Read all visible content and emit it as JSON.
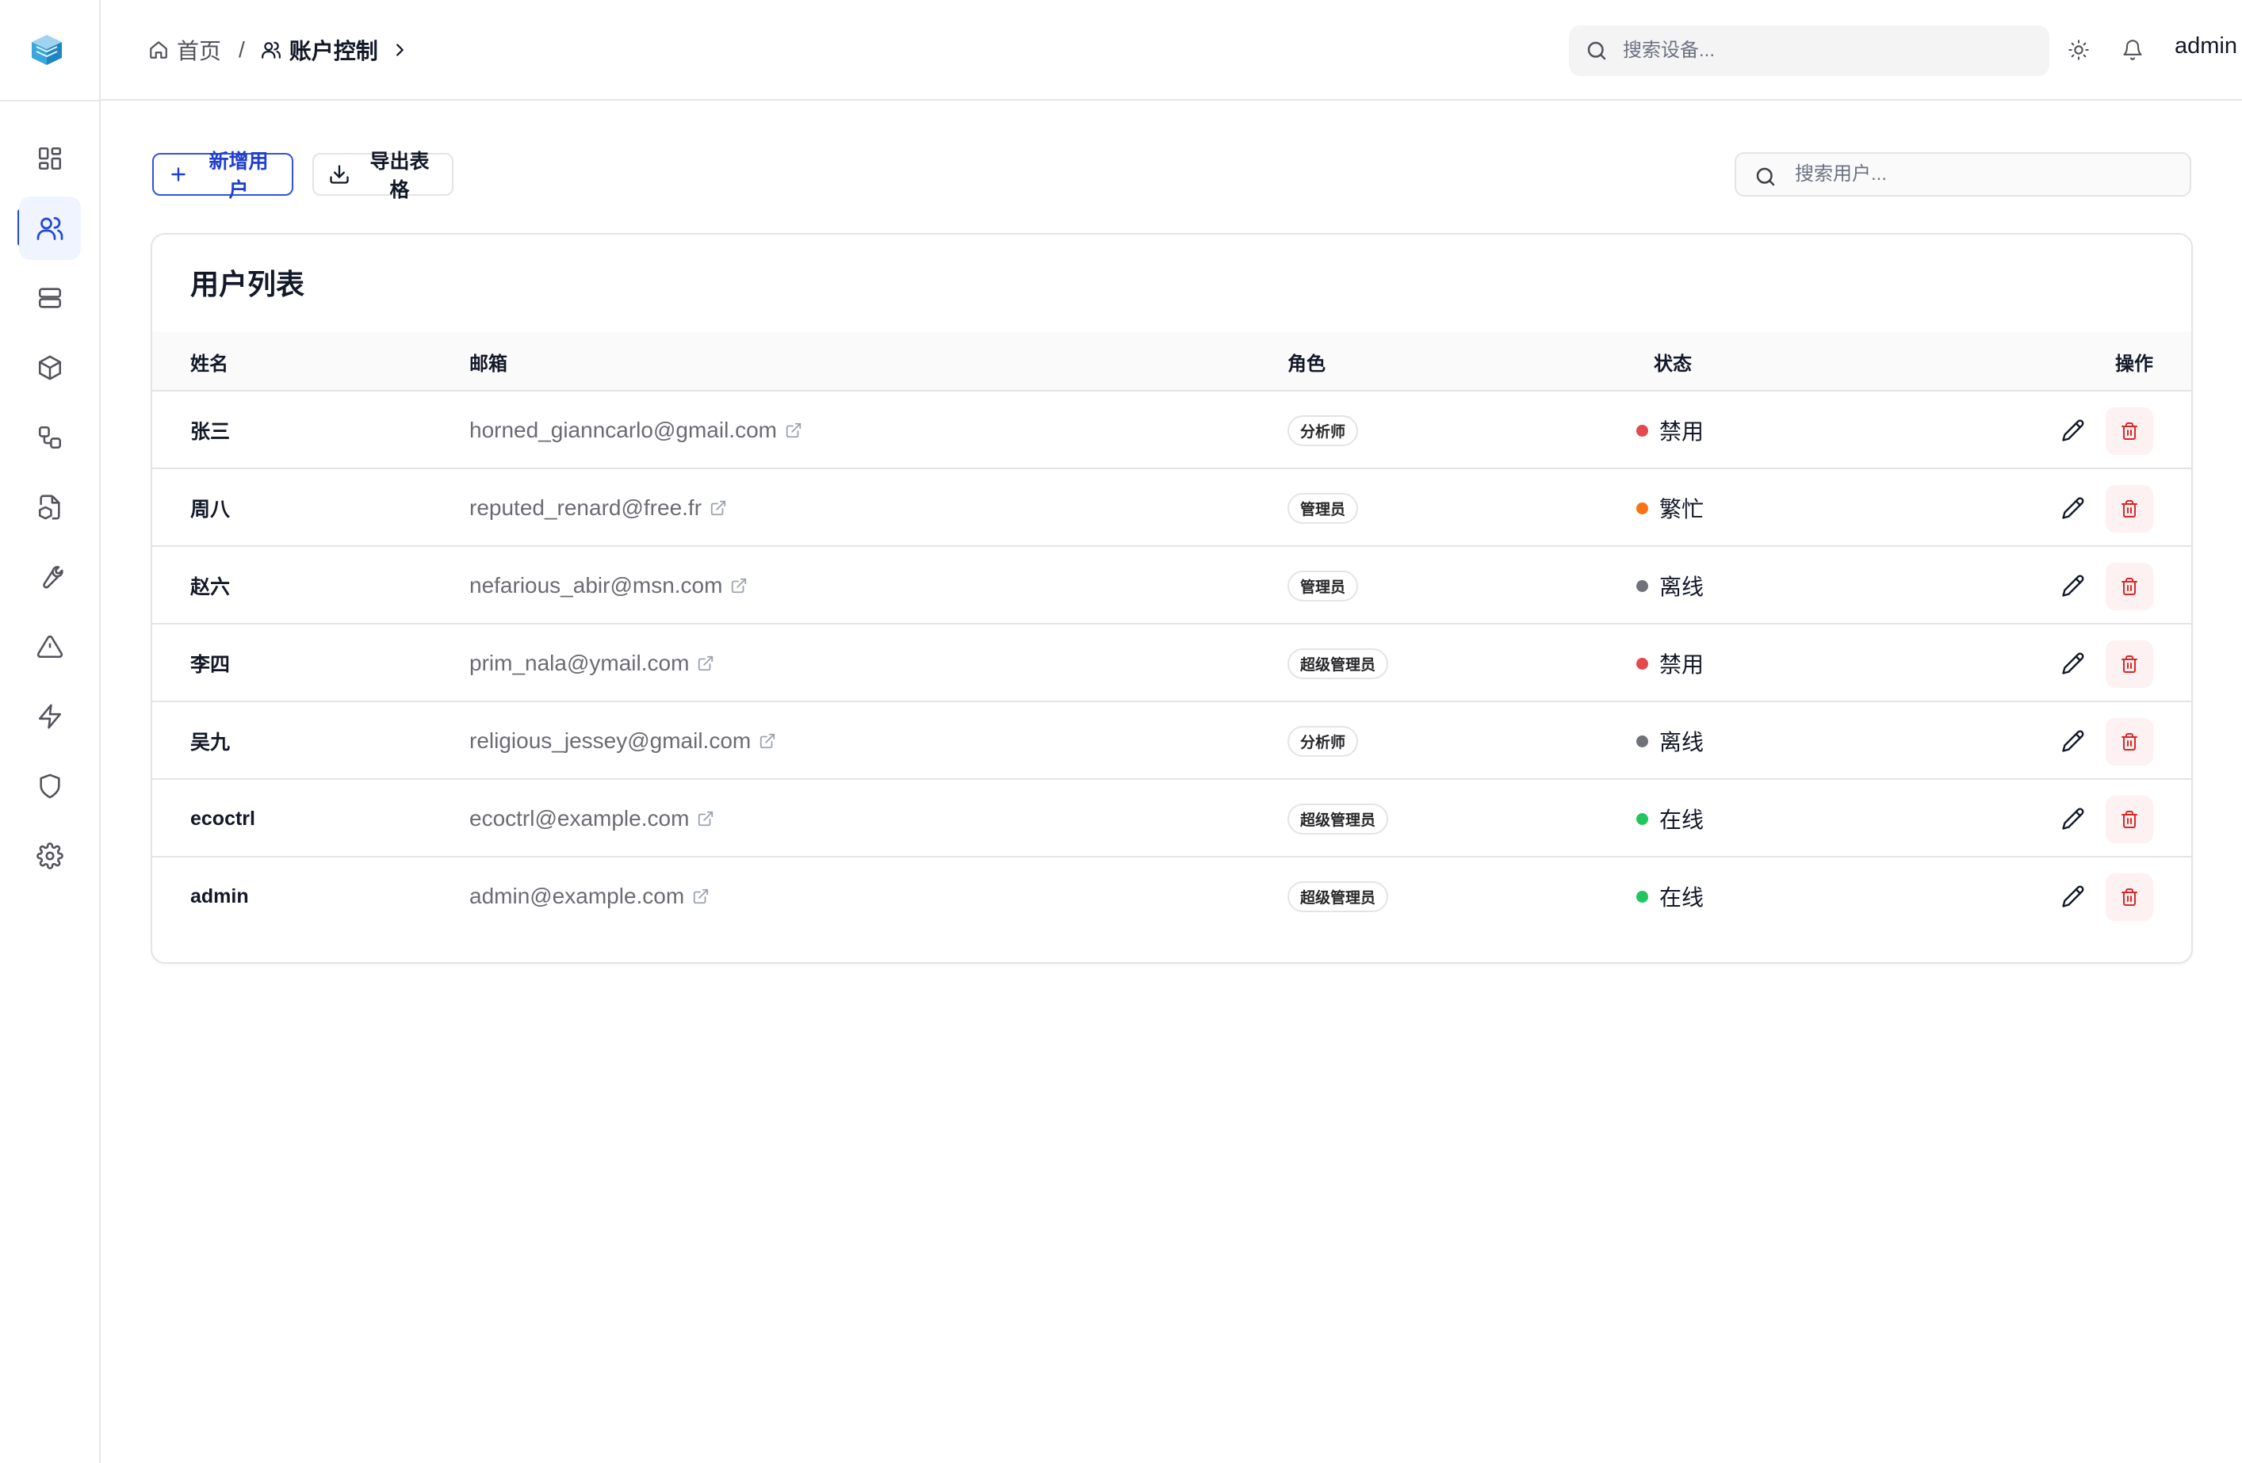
{
  "sidebar": {
    "items": [
      {
        "name": "dashboard",
        "icon": "dashboard-grid-icon"
      },
      {
        "name": "users",
        "icon": "users-icon",
        "active": true
      },
      {
        "name": "servers",
        "icon": "server-icon"
      },
      {
        "name": "packages",
        "icon": "cube-icon"
      },
      {
        "name": "topology",
        "icon": "workflow-icon"
      },
      {
        "name": "reports",
        "icon": "file-cube-icon"
      },
      {
        "name": "tools",
        "icon": "wrench-icon"
      },
      {
        "name": "alerts",
        "icon": "warning-triangle-icon"
      },
      {
        "name": "automation",
        "icon": "lightning-icon"
      },
      {
        "name": "security",
        "icon": "shield-icon"
      },
      {
        "name": "settings",
        "icon": "gear-icon"
      }
    ]
  },
  "header": {
    "breadcrumb": {
      "home": "首页",
      "separator": "/",
      "current": "账户控制"
    },
    "search_placeholder": "搜索设备...",
    "username": "admin"
  },
  "toolbar": {
    "add_label": "新增用户",
    "export_label": "导出表格",
    "search_placeholder": "搜索用户..."
  },
  "card": {
    "title": "用户列表",
    "columns": {
      "name": "姓名",
      "email": "邮箱",
      "role": "角色",
      "status": "状态",
      "actions": "操作"
    },
    "rows": [
      {
        "name": "张三",
        "email": "horned_gianncarlo@gmail.com",
        "role": "分析师",
        "status": "禁用",
        "status_color": "#e5484d"
      },
      {
        "name": "周八",
        "email": "reputed_renard@free.fr",
        "role": "管理员",
        "status": "繁忙",
        "status_color": "#f97316"
      },
      {
        "name": "赵六",
        "email": "nefarious_abir@msn.com",
        "role": "管理员",
        "status": "离线",
        "status_color": "#71717a"
      },
      {
        "name": "李四",
        "email": "prim_nala@ymail.com",
        "role": "超级管理员",
        "status": "禁用",
        "status_color": "#e5484d"
      },
      {
        "name": "吴九",
        "email": "religious_jessey@gmail.com",
        "role": "分析师",
        "status": "离线",
        "status_color": "#71717a"
      },
      {
        "name": "ecoctrl",
        "email": "ecoctrl@example.com",
        "role": "超级管理员",
        "status": "在线",
        "status_color": "#22c55e"
      },
      {
        "name": "admin",
        "email": "admin@example.com",
        "role": "超级管理员",
        "status": "在线",
        "status_color": "#22c55e"
      }
    ]
  },
  "colors": {
    "accent": "#2447d6",
    "danger": "#dc2626"
  }
}
